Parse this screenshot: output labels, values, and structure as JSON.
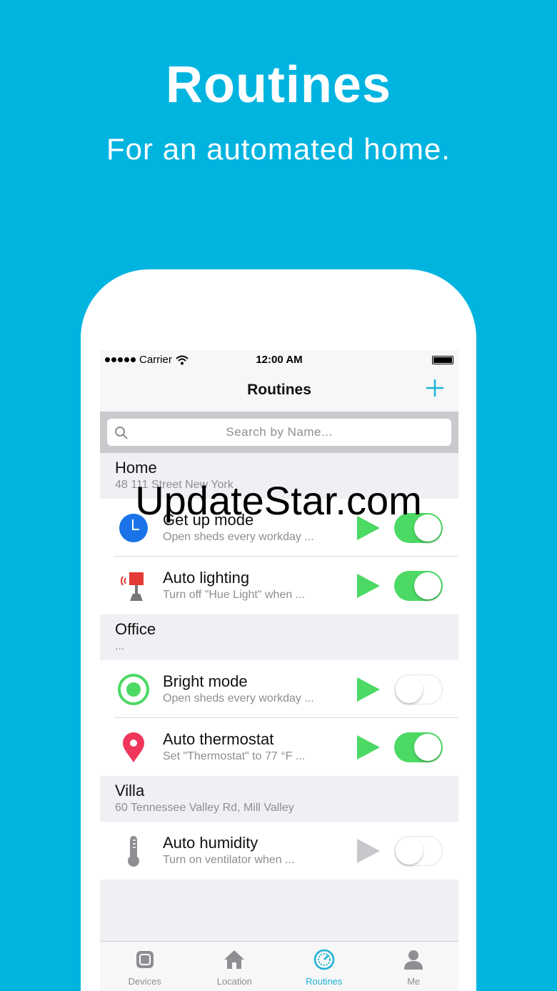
{
  "hero": {
    "title": "Routines",
    "subtitle": "For an automated home."
  },
  "status_bar": {
    "carrier": "Carrier",
    "time": "12:00 AM"
  },
  "nav": {
    "title": "Routines",
    "add_icon": "plus-icon"
  },
  "search": {
    "placeholder": "Search by Name..."
  },
  "sections": [
    {
      "title": "Home",
      "subtitle": "48 111 Street New York",
      "rows": [
        {
          "title": "Get up mode",
          "subtitle": "Open sheds every workday ...",
          "icon": "clock-icon",
          "play_enabled": true,
          "toggle_on": true
        },
        {
          "title": "Auto lighting",
          "subtitle": "Turn off \"Hue Light\" when ...",
          "icon": "lamp-icon",
          "play_enabled": true,
          "toggle_on": true
        }
      ]
    },
    {
      "title": "Office",
      "subtitle": "...",
      "rows": [
        {
          "title": "Bright mode",
          "subtitle": "Open sheds every workday ...",
          "icon": "target-icon",
          "play_enabled": true,
          "toggle_on": false
        },
        {
          "title": "Auto thermostat",
          "subtitle": "Set \"Thermostat\" to 77 °F ...",
          "icon": "location-pin-icon",
          "play_enabled": true,
          "toggle_on": true
        }
      ]
    },
    {
      "title": "Villa",
      "subtitle": "60 Tennessee Valley Rd, Mill Valley",
      "rows": [
        {
          "title": "Auto humidity",
          "subtitle": "Turn on ventilator when ...",
          "icon": "thermometer-icon",
          "play_enabled": false,
          "toggle_on": false
        }
      ]
    }
  ],
  "tabs": [
    {
      "label": "Devices",
      "icon": "devices-icon",
      "active": false
    },
    {
      "label": "Location",
      "icon": "house-icon",
      "active": false
    },
    {
      "label": "Routines",
      "icon": "gauge-icon",
      "active": true
    },
    {
      "label": "Me",
      "icon": "person-icon",
      "active": false
    }
  ],
  "watermark": "UpdateStar.com",
  "colors": {
    "background": "#00b4e0",
    "accent": "#1cb0d8",
    "toggle_on": "#4cd964",
    "play": "#4cd964",
    "play_disabled": "#c7c7cc"
  }
}
